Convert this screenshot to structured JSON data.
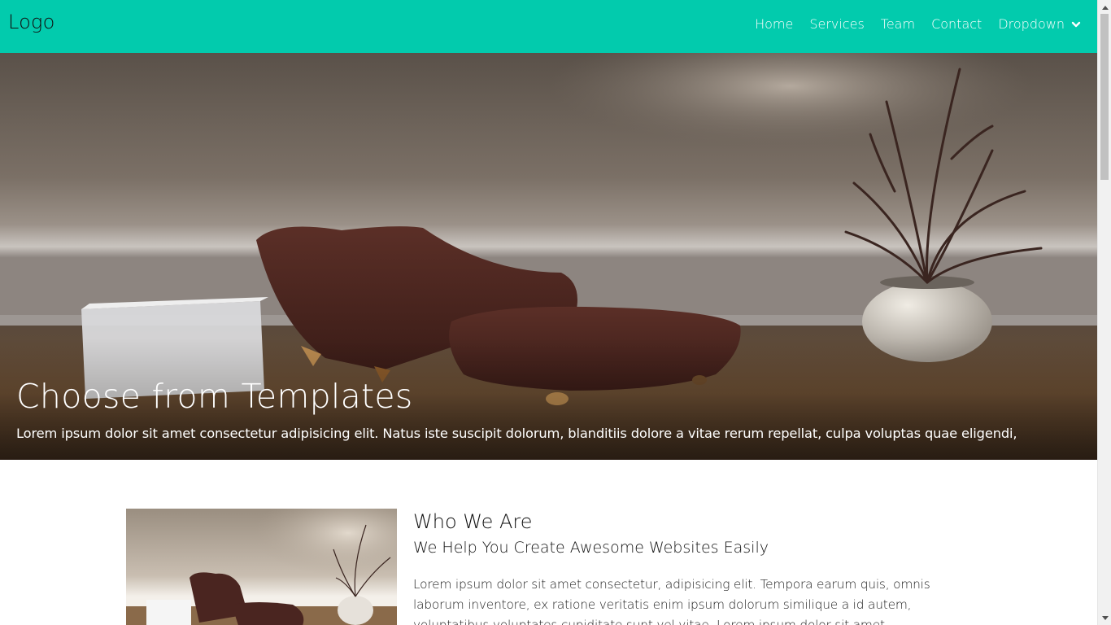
{
  "navbar": {
    "logo": "Logo",
    "items": [
      {
        "label": "Home"
      },
      {
        "label": "Services"
      },
      {
        "label": "Team"
      },
      {
        "label": "Contact"
      }
    ],
    "dropdown_label": "Dropdown",
    "bg_color": "#02cbad"
  },
  "hero": {
    "title": "Choose from Templates",
    "subtitle": "Lorem ipsum dolor sit amet consectetur adipisicing elit. Natus iste suscipit dolorum, blanditiis dolore a vitae rerum repellat, culpa voluptas quae eligendi,"
  },
  "about": {
    "heading": "Who We Are",
    "subheading": "We Help You Create Awesome Websites Easily",
    "paragraph": "Lorem ipsum dolor sit amet consectetur, adipisicing elit. Tempora earum quis, omnis laborum inventore, ex ratione veritatis enim ipsum dolorum similique a id autem, voluptatibus voluptates cupiditate sunt vel vitae. Lorem ipsum dolor sit amet"
  }
}
